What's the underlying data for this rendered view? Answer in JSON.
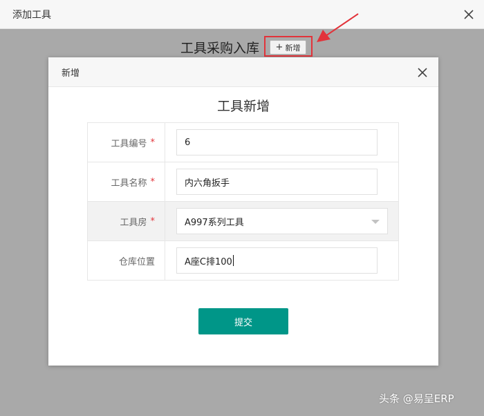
{
  "outer": {
    "title": "添加工具",
    "page_title": "工具采购入库",
    "add_button_label": "新增",
    "add_button_icon": "plus-icon"
  },
  "modal": {
    "title": "新增",
    "form_title": "工具新增",
    "fields": [
      {
        "label": "工具编号",
        "required": true,
        "value": ""
      },
      {
        "label": "工具名称",
        "required": true,
        "value": "内六角扳手"
      },
      {
        "label": "工具房",
        "required": true,
        "value": "A997系列工具"
      },
      {
        "label": "仓库位置",
        "required": false,
        "value": "A座C排100"
      }
    ],
    "tool_number_value": "6",
    "submit_label": "提交",
    "required_mark": "*"
  },
  "watermark": "头条 @易呈ERP",
  "colors": {
    "accent": "#009688",
    "highlight": "#e2333a",
    "overlay": "#a9a9a9"
  }
}
